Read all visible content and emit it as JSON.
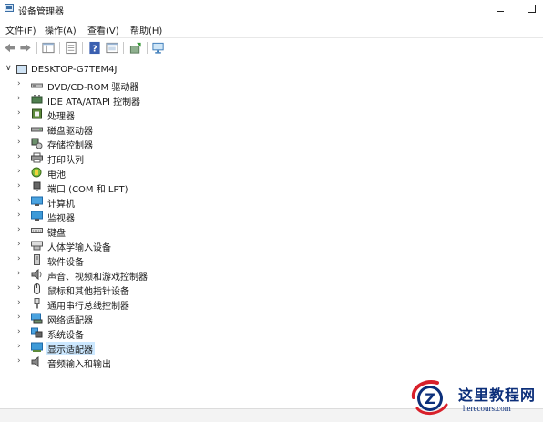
{
  "window": {
    "title": "设备管理器",
    "minimize": "—",
    "maximize": "□"
  },
  "menu": [
    "文件(F)",
    "操作(A)",
    "查看(V)",
    "帮助(H)"
  ],
  "tree": {
    "root": "DESKTOP-G7TEM4J",
    "items": [
      {
        "label": "DVD/CD-ROM 驱动器",
        "icon": "dvd-drive-icon"
      },
      {
        "label": "IDE ATA/ATAPI 控制器",
        "icon": "ide-controller-icon"
      },
      {
        "label": "处理器",
        "icon": "processor-icon"
      },
      {
        "label": "磁盘驱动器",
        "icon": "disk-drive-icon"
      },
      {
        "label": "存储控制器",
        "icon": "storage-controller-icon"
      },
      {
        "label": "打印队列",
        "icon": "printer-icon"
      },
      {
        "label": "电池",
        "icon": "battery-icon"
      },
      {
        "label": "端口 (COM 和 LPT)",
        "icon": "port-icon"
      },
      {
        "label": "计算机",
        "icon": "computer-icon"
      },
      {
        "label": "监视器",
        "icon": "monitor-icon"
      },
      {
        "label": "键盘",
        "icon": "keyboard-icon"
      },
      {
        "label": "人体学输入设备",
        "icon": "hid-icon"
      },
      {
        "label": "软件设备",
        "icon": "software-device-icon"
      },
      {
        "label": "声音、视频和游戏控制器",
        "icon": "sound-icon"
      },
      {
        "label": "鼠标和其他指针设备",
        "icon": "mouse-icon"
      },
      {
        "label": "通用串行总线控制器",
        "icon": "usb-icon"
      },
      {
        "label": "网络适配器",
        "icon": "network-adapter-icon"
      },
      {
        "label": "系统设备",
        "icon": "system-device-icon"
      },
      {
        "label": "显示适配器",
        "icon": "display-adapter-icon",
        "selected": true
      },
      {
        "label": "音频输入和输出",
        "icon": "audio-io-icon"
      }
    ]
  },
  "watermark": {
    "title": "这里教程网",
    "subtitle": "herecours.com"
  },
  "colors": {
    "selection": "#cce8ff",
    "accent": "#3a6ea5",
    "watermark": "#0c2f7a",
    "watermark_red": "#d8202a"
  }
}
